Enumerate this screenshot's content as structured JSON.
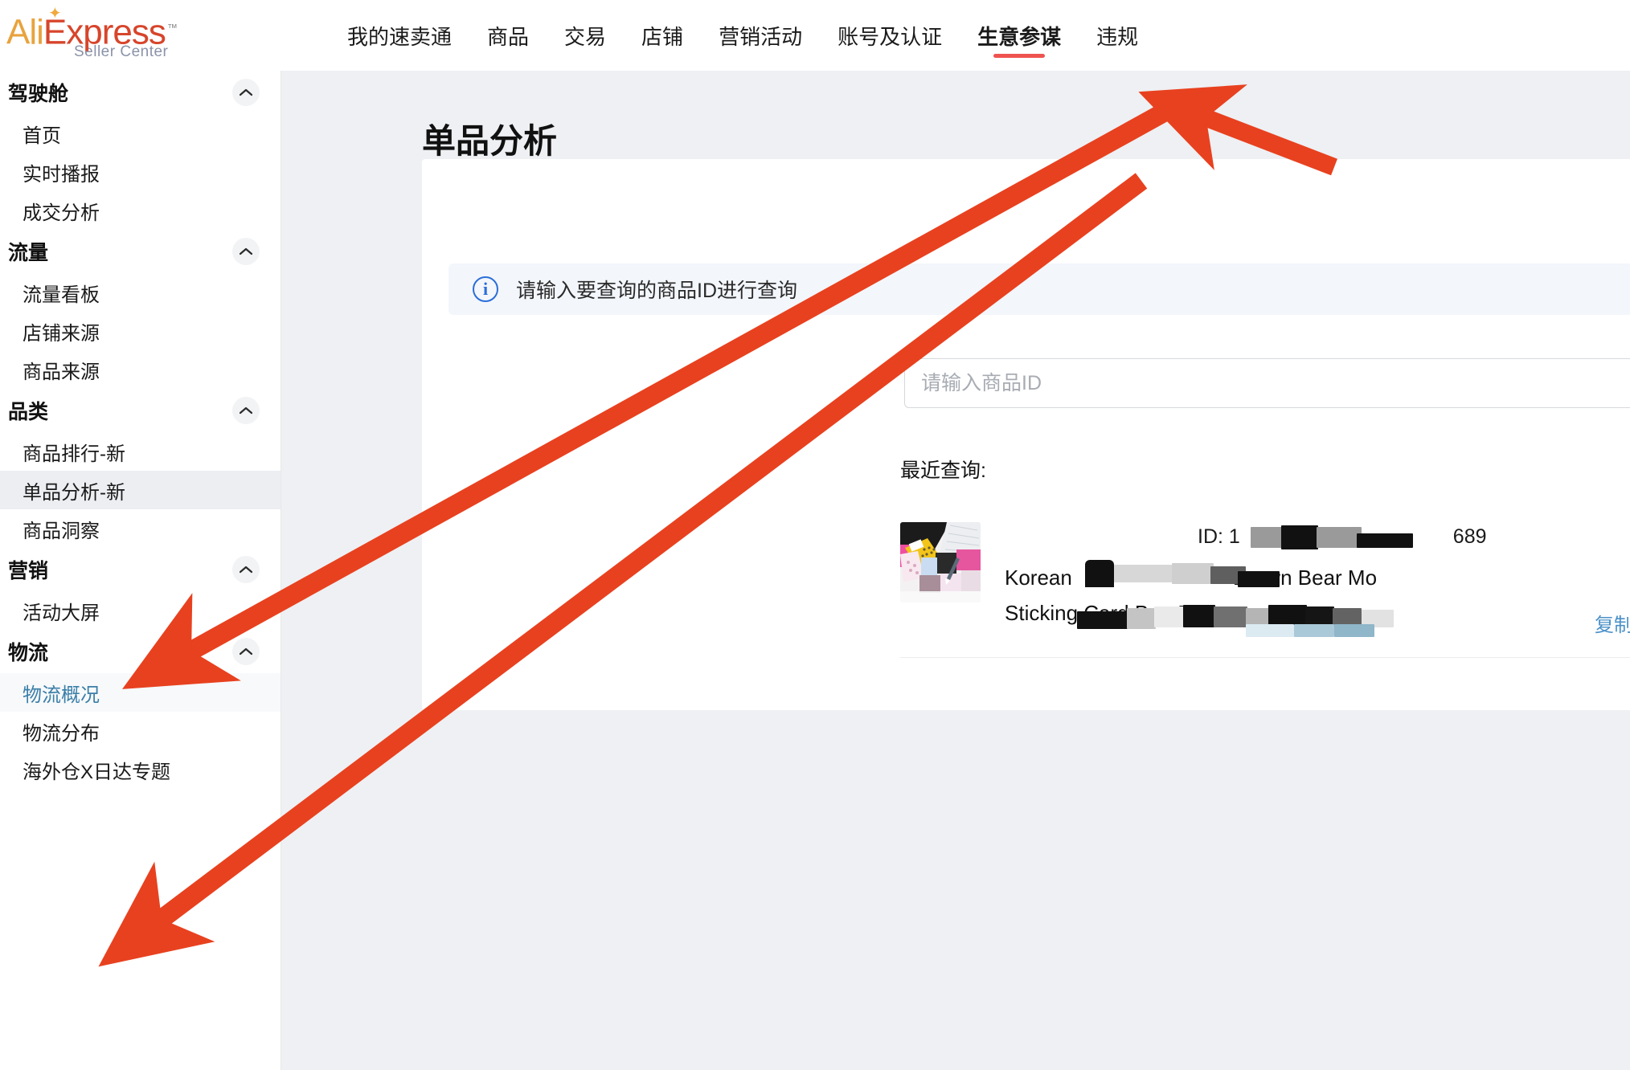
{
  "brand": {
    "logo_ali": "Ali",
    "logo_e": "E",
    "logo_xpress": "xpress",
    "logo_tm": "™",
    "logo_sub": "Seller Center"
  },
  "topnav": {
    "items": [
      {
        "label": "我的速卖通",
        "active": false
      },
      {
        "label": "商品",
        "active": false
      },
      {
        "label": "交易",
        "active": false
      },
      {
        "label": "店铺",
        "active": false
      },
      {
        "label": "营销活动",
        "active": false
      },
      {
        "label": "账号及认证",
        "active": false
      },
      {
        "label": "生意参谋",
        "active": true
      },
      {
        "label": "违规",
        "active": false
      }
    ],
    "active_accent": "#ef5350"
  },
  "sidebar": {
    "groups": [
      {
        "title": "驾驶舱",
        "items": [
          {
            "label": "首页",
            "state": "normal"
          },
          {
            "label": "实时播报",
            "state": "normal"
          },
          {
            "label": "成交分析",
            "state": "normal"
          }
        ]
      },
      {
        "title": "流量",
        "items": [
          {
            "label": "流量看板",
            "state": "normal"
          },
          {
            "label": "店铺来源",
            "state": "normal"
          },
          {
            "label": "商品来源",
            "state": "normal"
          }
        ]
      },
      {
        "title": "品类",
        "items": [
          {
            "label": "商品排行-新",
            "state": "normal"
          },
          {
            "label": "单品分析-新",
            "state": "selected"
          },
          {
            "label": "商品洞察",
            "state": "normal"
          }
        ]
      },
      {
        "title": "营销",
        "items": [
          {
            "label": "活动大屏",
            "state": "normal"
          }
        ]
      },
      {
        "title": "物流",
        "items": [
          {
            "label": "物流概况",
            "state": "current"
          },
          {
            "label": "物流分布",
            "state": "normal"
          },
          {
            "label": "海外仓X日达专题",
            "state": "normal"
          }
        ]
      }
    ]
  },
  "main": {
    "page_title": "单品分析",
    "info_banner": {
      "icon": "info-circle-icon",
      "text": "请输入要查询的商品ID进行查询"
    },
    "search": {
      "placeholder": "请输入商品ID",
      "value": ""
    },
    "recent": {
      "label": "最近查询:",
      "item": {
        "id_prefix": "ID: 1",
        "id_suffix": "689",
        "title_line1_start": "Korean",
        "title_line1_mid": "Brown Bear Mo",
        "title_line2_start": "Sticking Card Bag Bu",
        "copy_label": "复制标题",
        "thumbnail_alt": "product-thumbnail"
      }
    }
  },
  "annotations": {
    "arrow_color": "#e8411f",
    "arrows": [
      {
        "name": "arrow-to-shengyicanmou-nav"
      },
      {
        "name": "arrow-to-danpin-fenxi-xin"
      },
      {
        "name": "arrow-to-wuliu-gaikuang"
      }
    ]
  }
}
